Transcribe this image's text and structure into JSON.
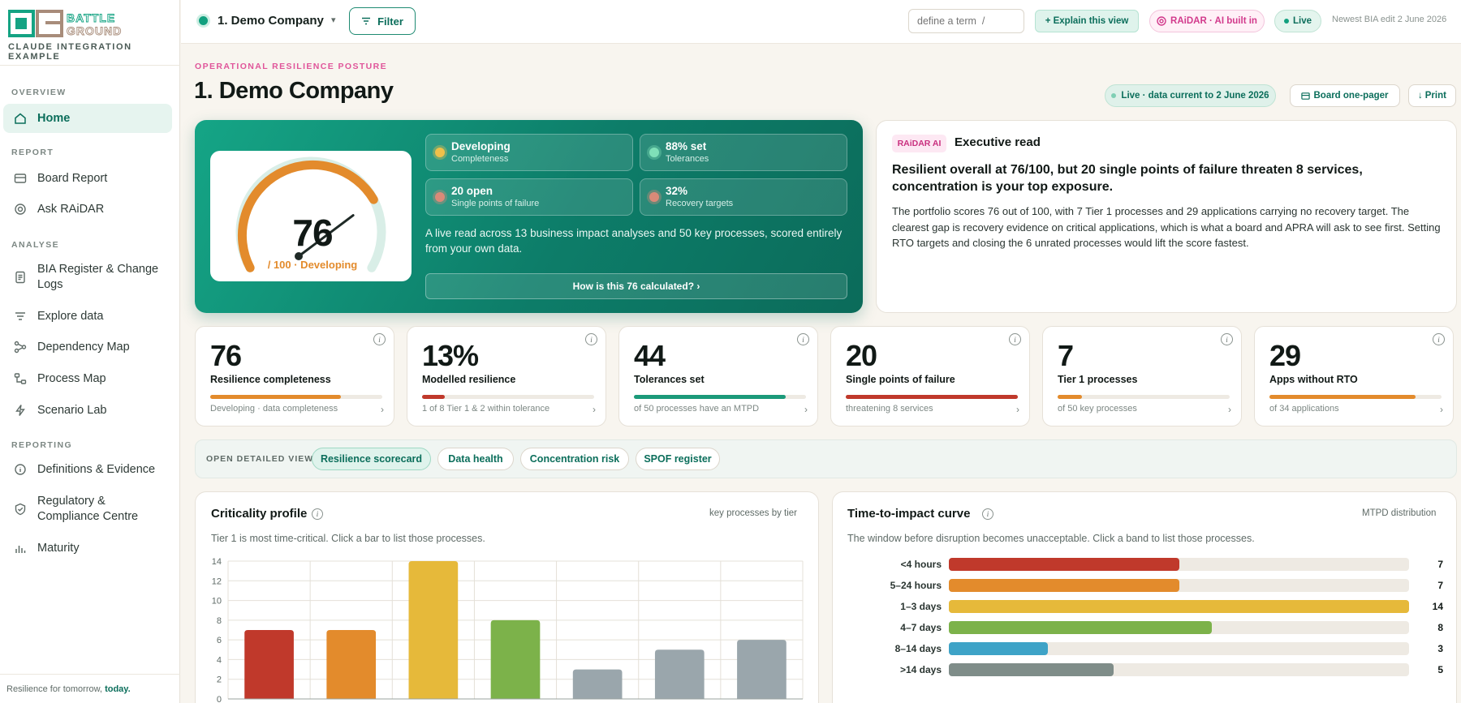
{
  "brand": {
    "logo_text": "BATTLE GROUND",
    "logo_letters": "BG",
    "subtitle": "CLAUDE INTEGRATION EXAMPLE",
    "colors": {
      "primary": "#0b6e5b",
      "accent": "#e0559a"
    }
  },
  "sidebar": {
    "sections": {
      "overview": "OVERVIEW",
      "report": "REPORT",
      "analyse": "ANALYSE",
      "reporting": "REPORTING"
    },
    "items": [
      {
        "label": "Home",
        "icon": "home-icon"
      },
      {
        "label": "Board Report",
        "icon": "board-icon"
      },
      {
        "label": "Ask RAiDAR",
        "icon": "target-icon"
      },
      {
        "label": "BIA Register & Change Logs",
        "icon": "document-icon"
      },
      {
        "label": "Explore data",
        "icon": "filter-lines-icon"
      },
      {
        "label": "Dependency Map",
        "icon": "network-icon"
      },
      {
        "label": "Process Map",
        "icon": "flow-icon"
      },
      {
        "label": "Scenario Lab",
        "icon": "lightning-icon"
      },
      {
        "label": "Definitions & Evidence",
        "icon": "info-icon"
      },
      {
        "label": "Regulatory & Compliance Centre",
        "icon": "shield-icon"
      },
      {
        "label": "Maturity",
        "icon": "bar-chart-icon"
      }
    ],
    "footer": {
      "text": "Resilience for tomorrow,",
      "bold": "today."
    }
  },
  "topbar": {
    "company": "1. Demo Company",
    "caret": "▾",
    "filter": "Filter",
    "define_placeholder": "define a term  /",
    "explain": "+ Explain this view",
    "raidar": "RAiDAR · AI built in",
    "live": "Live",
    "newest": "Newest BIA edit 2 June 2026"
  },
  "header": {
    "eyebrow": "OPERATIONAL RESILIENCE POSTURE",
    "title": "1. Demo Company",
    "live_pill": "Live · data current to 2 June 2026",
    "board_button": "Board one-pager",
    "print_button": "Print"
  },
  "hero": {
    "score": "76",
    "score_value": 76,
    "score_sub": "/ 100 · Developing",
    "stats": [
      {
        "title": "Developing",
        "sub": "Completeness",
        "dot": "#f0c04a"
      },
      {
        "title": "88% set",
        "sub": "Tolerances",
        "dot": "#7fe0b8"
      },
      {
        "title": "20 open",
        "sub": "Single points of failure",
        "dot": "#d98a78"
      },
      {
        "title": "32%",
        "sub": "Recovery targets",
        "dot": "#d98a78"
      }
    ],
    "text": "A live read across 13 business impact analyses and 50 key processes, scored entirely from your own data.",
    "button": "How is this 76 calculated? ›"
  },
  "exec": {
    "tag": "RAiDAR AI",
    "title": "Executive read",
    "headline": "Resilient overall at 76/100, but 20 single points of failure threaten 8 services, concentration is your top exposure.",
    "body": "The portfolio scores 76 out of 100, with 7 Tier 1 processes and 29 applications carrying no recovery target. The clearest gap is recovery evidence on critical applications, which is what a board and APRA will ask to see first. Setting RTO targets and closing the 6 unrated processes would lift the score fastest."
  },
  "kpis": [
    {
      "value": "76",
      "label": "Resilience completeness",
      "sub": "Developing · data completeness",
      "fill": 0.76,
      "color": "#e38b2c"
    },
    {
      "value": "13%",
      "label": "Modelled resilience",
      "sub": "1 of 8 Tier 1 & 2 within tolerance",
      "fill": 0.13,
      "color": "#c0392b"
    },
    {
      "value": "44",
      "label": "Tolerances set",
      "sub": "of 50 processes have an MTPD",
      "fill": 0.88,
      "color": "#1b9a7a"
    },
    {
      "value": "20",
      "label": "Single points of failure",
      "sub": "threatening 8 services",
      "fill": 1.0,
      "color": "#c0392b"
    },
    {
      "value": "7",
      "label": "Tier 1 processes",
      "sub": "of 50 key processes",
      "fill": 0.14,
      "color": "#e38b2c"
    },
    {
      "value": "29",
      "label": "Apps without RTO",
      "sub": "of 34 applications",
      "fill": 0.85,
      "color": "#e38b2c"
    }
  ],
  "detail_view": {
    "label": "OPEN DETAILED VIEW",
    "pills": [
      "Resilience scorecard",
      "Data health",
      "Concentration risk",
      "SPOF register"
    ]
  },
  "criticality": {
    "title": "Criticality profile",
    "right": "key processes by tier",
    "sub": "Tier 1 is most time-critical. Click a bar to list those processes."
  },
  "tti": {
    "title": "Time-to-impact curve",
    "right": "MTPD distribution",
    "sub": "The window before disruption becomes unacceptable. Click a band to list those processes.",
    "bands": [
      {
        "label": "<4 hours",
        "value": 7,
        "display": "7",
        "color": "#c0392b"
      },
      {
        "label": "5–24 hours",
        "value": 7,
        "display": "7",
        "color": "#e38b2c"
      },
      {
        "label": "1–3 days",
        "value": 14,
        "display": "14",
        "color": "#e6b93a"
      },
      {
        "label": "4–7 days",
        "value": 8,
        "display": "8",
        "color": "#7cb24a"
      },
      {
        "label": "8–14 days",
        "value": 3,
        "display": "3",
        "color": "#3ea3c7"
      },
      {
        "label": ">14 days",
        "value": 5,
        "display": "5",
        "color": "#7f8d89"
      }
    ]
  },
  "chart_data": {
    "type": "bar",
    "categories": [
      "",
      "",
      "",
      "",
      "",
      "",
      ""
    ],
    "values": [
      7,
      7,
      14,
      8,
      3,
      5,
      6
    ],
    "colors": [
      "#c0392b",
      "#e38b2c",
      "#e6b93a",
      "#7cb24a",
      "#9aa6ac",
      "#9aa6ac",
      "#9aa6ac"
    ],
    "ylim": [
      0,
      14
    ],
    "yticks": [
      0,
      2,
      4,
      6,
      8,
      10,
      12,
      14
    ],
    "grid": true,
    "title": "",
    "xlabel": "",
    "ylabel": ""
  }
}
